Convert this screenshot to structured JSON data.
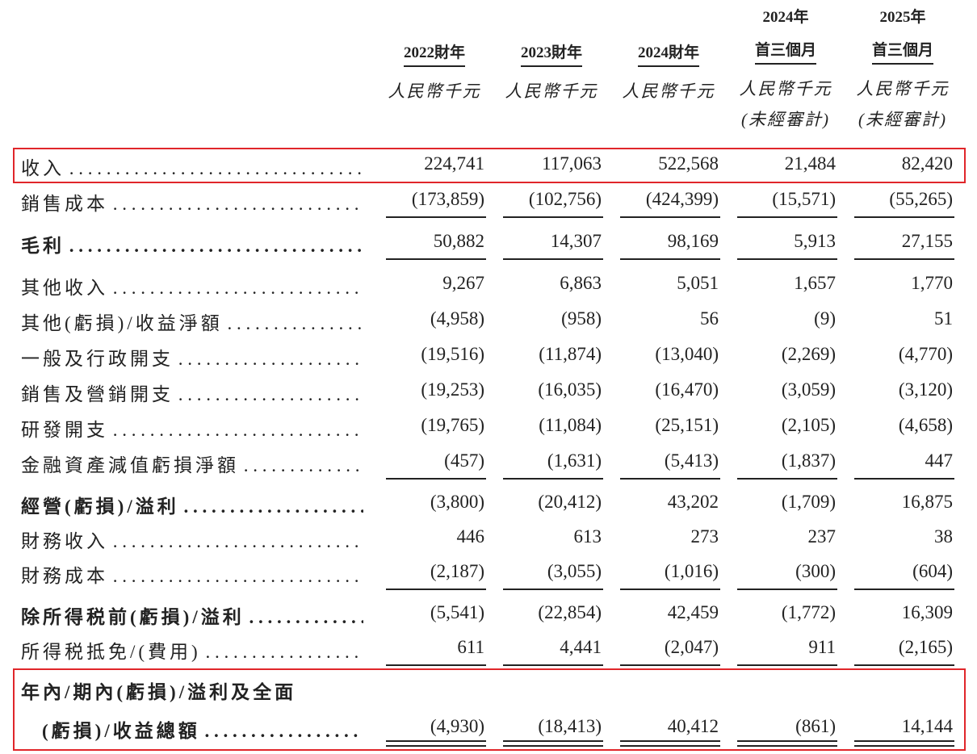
{
  "headers": {
    "cols": [
      {
        "top": "",
        "year": "2022財年",
        "currency": "人民幣千元",
        "audit": ""
      },
      {
        "top": "",
        "year": "2023財年",
        "currency": "人民幣千元",
        "audit": ""
      },
      {
        "top": "",
        "year": "2024財年",
        "currency": "人民幣千元",
        "audit": ""
      },
      {
        "top": "2024年",
        "year": "首三個月",
        "currency": "人民幣千元",
        "audit": "(未經審計)"
      },
      {
        "top": "2025年",
        "year": "首三個月",
        "currency": "人民幣千元",
        "audit": "(未經審計)"
      }
    ]
  },
  "rows": [
    {
      "label": "收入",
      "values": [
        "224,741",
        "117,063",
        "522,568",
        "21,484",
        "82,420"
      ]
    },
    {
      "label": "銷售成本",
      "values": [
        "(173,859)",
        "(102,756)",
        "(424,399)",
        "(15,571)",
        "(55,265)"
      ]
    },
    {
      "label": "毛利",
      "values": [
        "50,882",
        "14,307",
        "98,169",
        "5,913",
        "27,155"
      ]
    },
    {
      "label": "其他收入",
      "values": [
        "9,267",
        "6,863",
        "5,051",
        "1,657",
        "1,770"
      ]
    },
    {
      "label": "其他(虧損)/收益淨額",
      "values": [
        "(4,958)",
        "(958)",
        "56",
        "(9)",
        "51"
      ]
    },
    {
      "label": "一般及行政開支",
      "values": [
        "(19,516)",
        "(11,874)",
        "(13,040)",
        "(2,269)",
        "(4,770)"
      ]
    },
    {
      "label": "銷售及營銷開支",
      "values": [
        "(19,253)",
        "(16,035)",
        "(16,470)",
        "(3,059)",
        "(3,120)"
      ]
    },
    {
      "label": "研發開支",
      "values": [
        "(19,765)",
        "(11,084)",
        "(25,151)",
        "(2,105)",
        "(4,658)"
      ]
    },
    {
      "label": "金融資產減值虧損淨額",
      "values": [
        "(457)",
        "(1,631)",
        "(5,413)",
        "(1,837)",
        "447"
      ]
    },
    {
      "label": "經營(虧損)/溢利",
      "values": [
        "(3,800)",
        "(20,412)",
        "43,202",
        "(1,709)",
        "16,875"
      ]
    },
    {
      "label": "財務收入",
      "values": [
        "446",
        "613",
        "273",
        "237",
        "38"
      ]
    },
    {
      "label": "財務成本",
      "values": [
        "(2,187)",
        "(3,055)",
        "(1,016)",
        "(300)",
        "(604)"
      ]
    },
    {
      "label": "除所得税前(虧損)/溢利",
      "values": [
        "(5,541)",
        "(22,854)",
        "42,459",
        "(1,772)",
        "16,309"
      ]
    },
    {
      "label": "所得税抵免/(費用)",
      "values": [
        "611",
        "4,441",
        "(2,047)",
        "911",
        "(2,165)"
      ]
    }
  ],
  "total": {
    "label_line1": "年內/期內(虧損)/溢利及全面",
    "label_line2": "(虧損)/收益總額",
    "values": [
      "(4,930)",
      "(18,413)",
      "40,412",
      "(861)",
      "14,144"
    ]
  },
  "highlight_color": "#e0262a"
}
